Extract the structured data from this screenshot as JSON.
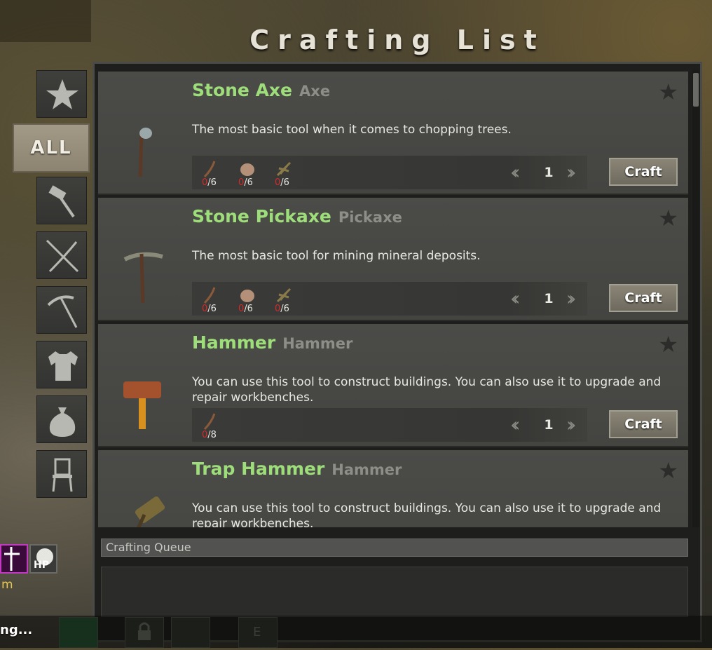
{
  "window": {
    "title": "Crafting List"
  },
  "sidebar": {
    "all_label": "ALL",
    "categories": [
      {
        "icon": "star-icon"
      },
      {
        "icon": "hammer-icon"
      },
      {
        "icon": "swords-icon"
      },
      {
        "icon": "pickaxe-icon"
      },
      {
        "icon": "shirt-icon"
      },
      {
        "icon": "bag-icon"
      },
      {
        "icon": "chair-icon"
      }
    ]
  },
  "recipes": [
    {
      "name": "Stone Axe",
      "type": "Axe",
      "description": "The most basic tool when it comes to chopping trees.",
      "materials": [
        {
          "icon": "branch-icon",
          "have": "0",
          "need": "/6"
        },
        {
          "icon": "stone-icon",
          "have": "0",
          "need": "/6"
        },
        {
          "icon": "fiber-icon",
          "have": "0",
          "need": "/6"
        }
      ],
      "quantity": "1",
      "craft_label": "Craft"
    },
    {
      "name": "Stone Pickaxe",
      "type": "Pickaxe",
      "description": "The most basic tool for mining mineral deposits.",
      "materials": [
        {
          "icon": "branch-icon",
          "have": "0",
          "need": "/6"
        },
        {
          "icon": "stone-icon",
          "have": "0",
          "need": "/6"
        },
        {
          "icon": "fiber-icon",
          "have": "0",
          "need": "/6"
        }
      ],
      "quantity": "1",
      "craft_label": "Craft"
    },
    {
      "name": "Hammer",
      "type": "Hammer",
      "description": "You can use this tool to construct buildings. You can also use it to upgrade and repair workbenches.",
      "materials": [
        {
          "icon": "branch-icon",
          "have": "0",
          "need": "/8"
        }
      ],
      "quantity": "1",
      "craft_label": "Craft"
    },
    {
      "name": "Trap Hammer",
      "type": "Hammer",
      "description": "You can use this tool to construct buildings. You can also use it to upgrade and repair workbenches."
    }
  ],
  "queue": {
    "title": "Crafting Queue"
  },
  "hud": {
    "buff_label": "m",
    "hp_label": "HP",
    "loading_text": "ng...",
    "slot_key": "E"
  },
  "colors": {
    "item_name": "#9ede7a",
    "item_type": "#8e8e88",
    "missing_count": "#d62a2a",
    "craft_button": "#7c786a"
  }
}
